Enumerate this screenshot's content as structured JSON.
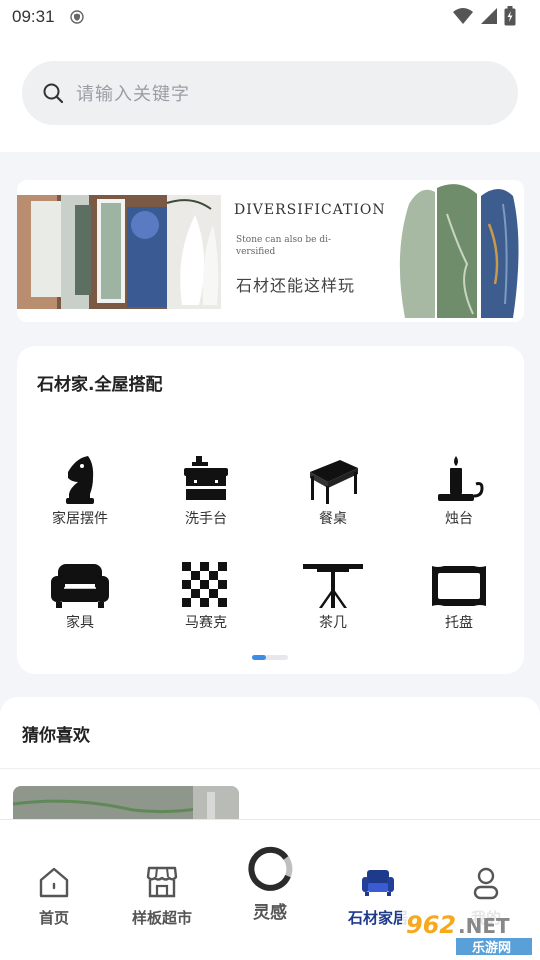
{
  "status_bar": {
    "time": "09:31",
    "icons": [
      "shield-icon",
      "wifi-icon",
      "signal-icon",
      "battery-charging-icon"
    ]
  },
  "search": {
    "placeholder": "请输入关键字",
    "icon": "search-icon"
  },
  "banner": {
    "title_en": "DIVERSIFICATION",
    "subtitle_line1": "Stone can also be di-",
    "subtitle_line2": "versified",
    "title_cn": "石材还能这样玩"
  },
  "category_card": {
    "title": "石材家.全屋搭配",
    "items": [
      {
        "label": "家居摆件",
        "icon": "chess-knight-icon"
      },
      {
        "label": "洗手台",
        "icon": "washbasin-icon"
      },
      {
        "label": "餐桌",
        "icon": "dining-table-icon"
      },
      {
        "label": "烛台",
        "icon": "candle-holder-icon"
      },
      {
        "label": "家具",
        "icon": "sofa-icon"
      },
      {
        "label": "马赛克",
        "icon": "mosaic-icon"
      },
      {
        "label": "茶几",
        "icon": "tea-table-icon"
      },
      {
        "label": "托盘",
        "icon": "tray-icon"
      }
    ],
    "pager": {
      "current_page": 1,
      "total_pages": 2
    }
  },
  "recommend": {
    "title": "猜你喜欢"
  },
  "bottom_nav": {
    "items": [
      {
        "label": "首页",
        "icon": "home-icon",
        "active": false
      },
      {
        "label": "样板超市",
        "icon": "store-icon",
        "active": false
      },
      {
        "label": "灵感",
        "icon": "inspiration-icon",
        "active": false
      },
      {
        "label": "石材家居",
        "icon": "armchair-icon",
        "active": true
      },
      {
        "label": "我的",
        "icon": "profile-icon",
        "active": false
      }
    ]
  },
  "watermark": {
    "number": "962",
    "domain": ".NET",
    "site": "乐游网"
  },
  "colors": {
    "page_bg": "#f3f5f9",
    "active_nav": "#1e3a8a",
    "pager_active": "#3a8ee6",
    "watermark_orange": "#f7a81b"
  }
}
